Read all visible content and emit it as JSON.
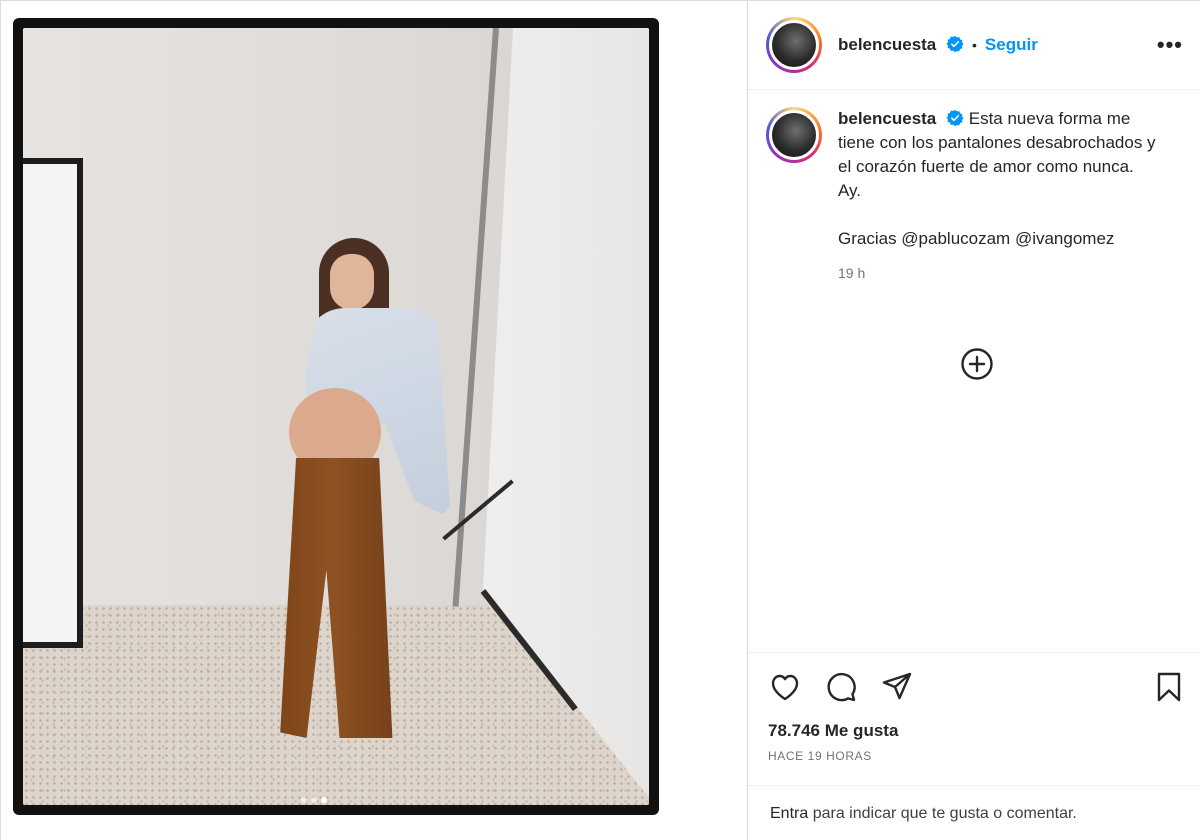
{
  "post": {
    "username": "belencuesta",
    "follow_label": "Seguir",
    "separator": "•",
    "more_label": "•••",
    "caption_lines": [
      "Esta nueva forma me tiene con los pantalones desabrochados y el corazón fuerte de amor como nunca.",
      "Ay."
    ],
    "caption_thanks": "Gracias @pablucozam @ivangomez",
    "caption_time": "19 h",
    "likes": "78.746 Me gusta",
    "posted_ago": "HACE 19 HORAS",
    "comment_prompt_link": "Entra",
    "comment_prompt_rest": " para indicar que te gusta o comentar."
  },
  "carousel": {
    "total": 3,
    "active_index": 2
  },
  "icons": {
    "verified": "verified-badge-icon",
    "add_comment": "plus-circle-icon",
    "like": "heart-icon",
    "comment": "comment-bubble-icon",
    "share": "paper-plane-icon",
    "save": "bookmark-icon"
  },
  "colors": {
    "accent": "#0095f6",
    "text": "#262626",
    "muted": "#737373"
  }
}
